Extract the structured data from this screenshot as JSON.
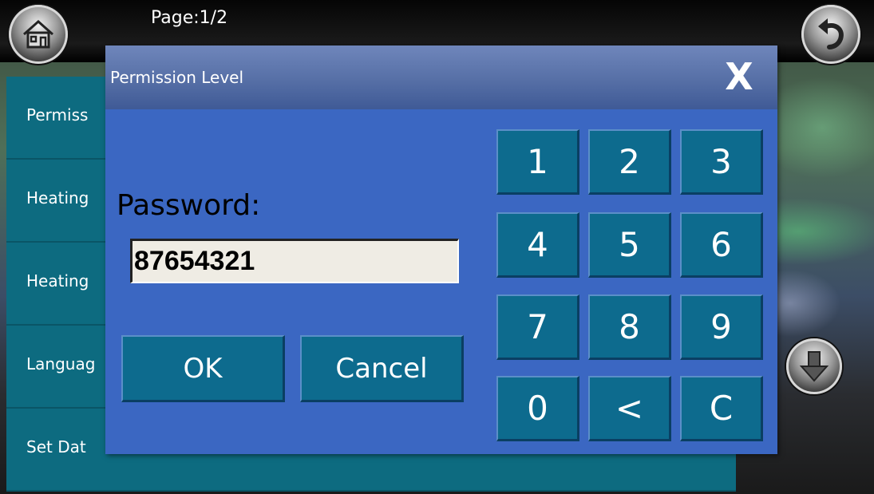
{
  "top_bar": {
    "page_indicator": "Page:1/2",
    "home_icon": "home-icon",
    "back_icon": "back-arrow-icon"
  },
  "menu": {
    "items": [
      {
        "label": "Permiss"
      },
      {
        "label": "Heating"
      },
      {
        "label": "Heating"
      },
      {
        "label": "Languag"
      },
      {
        "label": "Set Dat"
      }
    ],
    "scroll_down_icon": "down-arrow-icon"
  },
  "dialog": {
    "title": "Permission Level",
    "close_label": "X",
    "password_label": "Password:",
    "password_value": "87654321",
    "ok_label": "OK",
    "cancel_label": "Cancel",
    "keypad": [
      "1",
      "2",
      "3",
      "4",
      "5",
      "6",
      "7",
      "8",
      "9",
      "0",
      "<",
      "C"
    ]
  },
  "colors": {
    "dialog_bg": "#3b67c2",
    "key_bg": "#0d6b8e",
    "menu_bg": "#0d6b80"
  }
}
